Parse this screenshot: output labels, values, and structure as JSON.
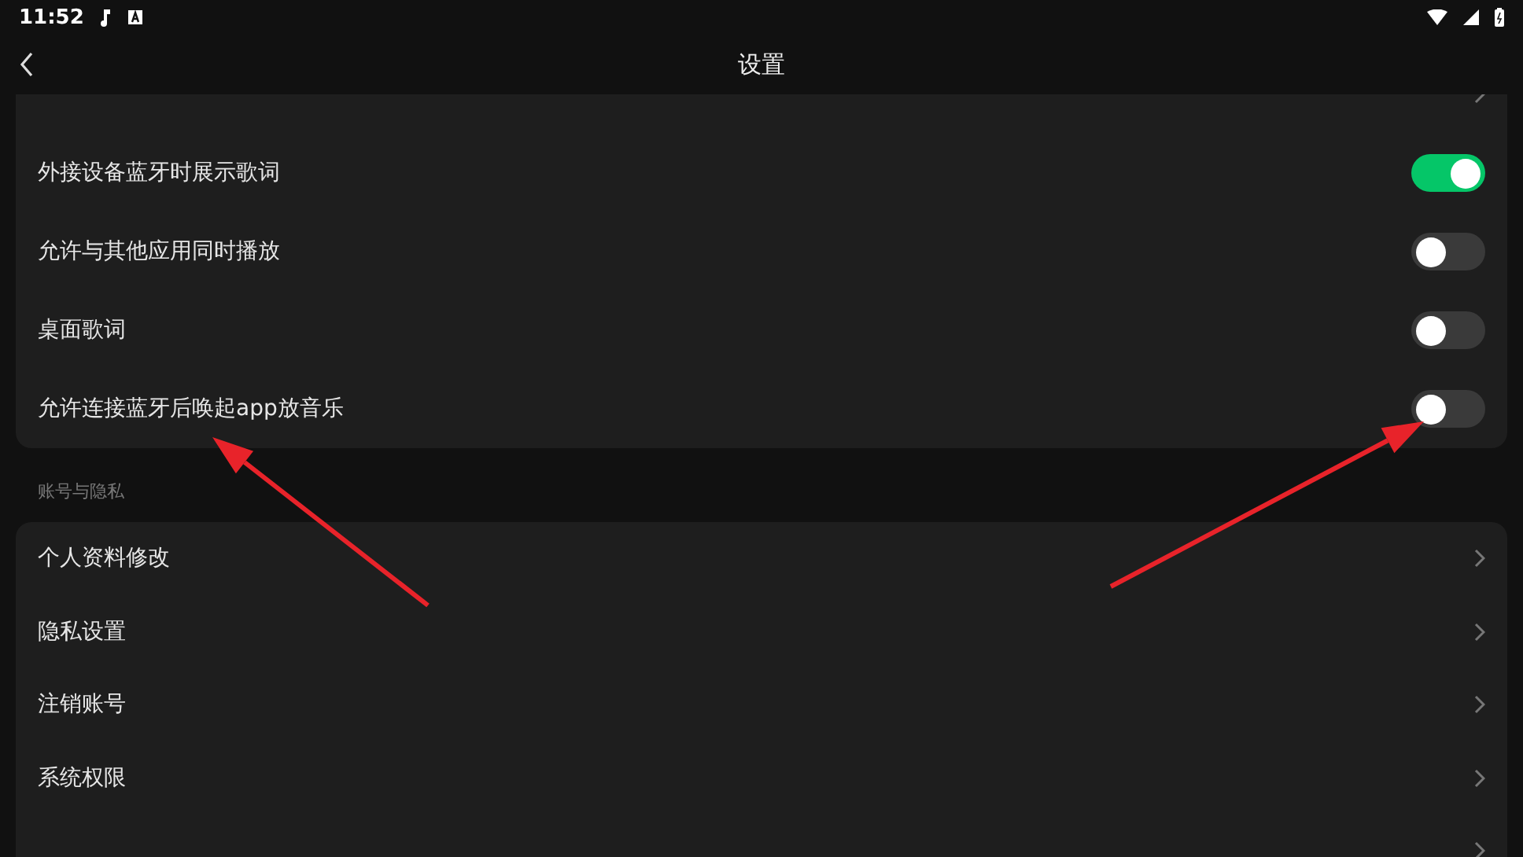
{
  "status_bar": {
    "time": "11:52"
  },
  "header": {
    "title": "设置"
  },
  "sections": [
    {
      "rows": [
        {
          "kind": "link"
        },
        {
          "kind": "toggle",
          "label": "外接设备蓝牙时展示歌词",
          "on": true
        },
        {
          "kind": "toggle",
          "label": "允许与其他应用同时播放",
          "on": false
        },
        {
          "kind": "toggle",
          "label": "桌面歌词",
          "on": false
        },
        {
          "kind": "toggle",
          "label": "允许连接蓝牙后唤起app放音乐",
          "on": false
        }
      ]
    },
    {
      "title": "账号与隐私",
      "rows": [
        {
          "kind": "link",
          "label": "个人资料修改"
        },
        {
          "kind": "link",
          "label": "隐私设置"
        },
        {
          "kind": "link",
          "label": "注销账号"
        },
        {
          "kind": "link",
          "label": "系统权限"
        },
        {
          "kind": "link"
        }
      ]
    }
  ],
  "annotations": [
    {
      "kind": "arrow"
    },
    {
      "kind": "arrow"
    }
  ]
}
